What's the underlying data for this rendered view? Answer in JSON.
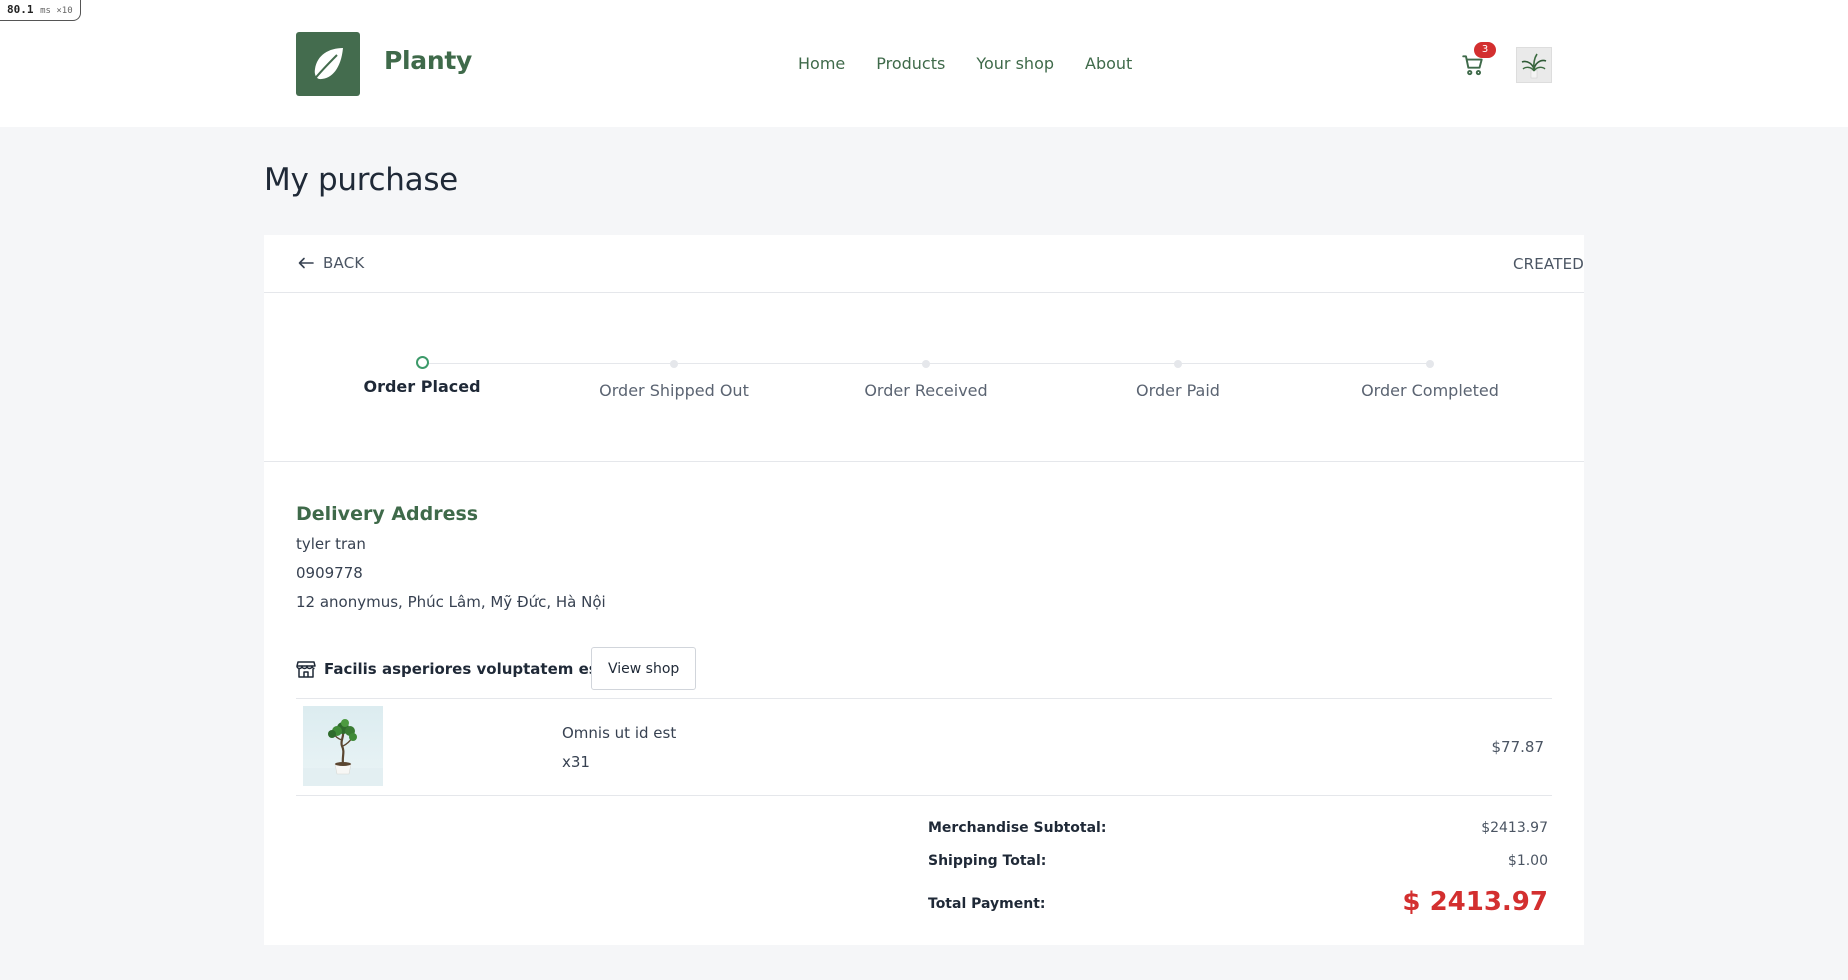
{
  "perf": {
    "value": "80.1",
    "unit": "ms ×10"
  },
  "header": {
    "brand": "Planty",
    "nav": [
      "Home",
      "Products",
      "Your shop",
      "About"
    ],
    "cart_count": "3"
  },
  "page_title": "My purchase",
  "order": {
    "back_label": "BACK",
    "status": "CREATED",
    "steps": [
      {
        "label": "Order Placed",
        "active": true
      },
      {
        "label": "Order Shipped Out",
        "active": false
      },
      {
        "label": "Order Received",
        "active": false
      },
      {
        "label": "Order Paid",
        "active": false
      },
      {
        "label": "Order Completed",
        "active": false
      }
    ],
    "delivery": {
      "title": "Delivery Address",
      "name": "tyler tran",
      "phone": "0909778",
      "address": "12 anonymus, Phúc Lâm, Mỹ Đức, Hà Nội"
    },
    "shop": {
      "name": "Facilis asperiores voluptatem est",
      "view_label": "View shop"
    },
    "item": {
      "name": "Omnis ut id est",
      "qty": "x31",
      "price": "$77.87"
    },
    "summary": {
      "subtotal_label": "Merchandise Subtotal:",
      "subtotal": "$2413.97",
      "shipping_label": "Shipping Total:",
      "shipping": "$1.00",
      "total_label": "Total Payment:",
      "total": "$ 2413.97"
    }
  },
  "colors": {
    "brand": "#3f6a4a",
    "accent": "#3d9a6a",
    "danger": "#d32f2f"
  },
  "icons": [
    "leaf-logo-icon",
    "cart-icon",
    "plant-avatar-icon",
    "arrow-left-icon",
    "store-icon"
  ]
}
